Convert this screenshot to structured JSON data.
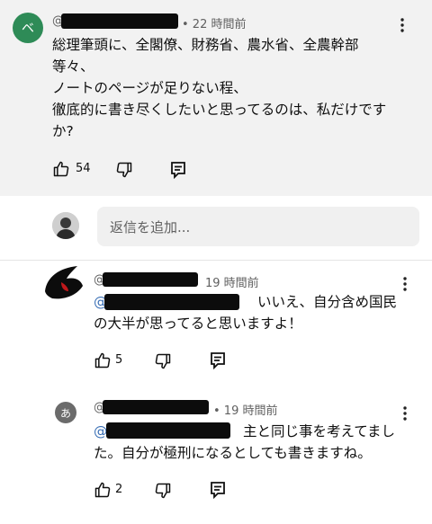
{
  "top_comment": {
    "avatar_letter": "ベ",
    "author_prefix": "@",
    "time": "• 22 時間前",
    "lines": [
      "総理筆頭に、全閣僚、財務省、農水省、全農幹部",
      "等々、",
      "ノートのページが足りない程、",
      "徹底的に書き尽くしたいと思ってるのは、私だけです",
      "か?"
    ],
    "like_count": "54"
  },
  "reply_box": {
    "placeholder": "返信を追加..."
  },
  "replies": [
    {
      "author_prefix": "@",
      "time": "19 時間前",
      "mention": "@",
      "line1": "いいえ、自分含め国民",
      "line2": "の大半が思ってると思いますよ！",
      "like_count": "5"
    },
    {
      "avatar_letter": "あ",
      "author_prefix": "@",
      "time": "• 19 時間前",
      "mention": "@",
      "line1": "主と同じ事を考えてまし",
      "line2": "た。自分が極刑になるとしても書きますね。",
      "like_count": "2"
    }
  ],
  "icons": {
    "more": "more-vertical-icon",
    "like": "thumbs-up-icon",
    "dislike": "thumbs-down-icon",
    "reply": "reply-comment-icon"
  },
  "colors": {
    "top_bg": "#f2f2f2",
    "avatar_green": "#2e8b57",
    "mention_blue": "#3a6fb5"
  }
}
